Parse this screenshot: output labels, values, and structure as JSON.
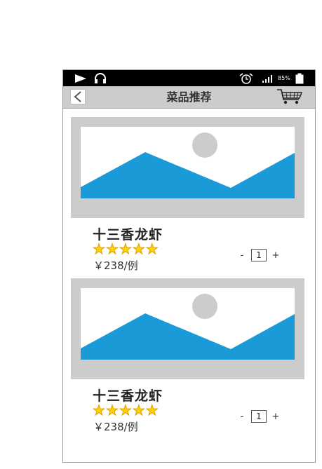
{
  "status_bar": {
    "play_icon": "play-icon",
    "headphones_icon": "headphones-icon",
    "alarm_icon": "alarm-clock-icon",
    "signal_icon": "signal-icon",
    "battery_percent": "85%",
    "battery_icon": "battery-icon"
  },
  "nav": {
    "back_icon": "chevron-left-icon",
    "title": "菜品推荐",
    "cart_icon": "shopping-cart-icon"
  },
  "colors": {
    "placeholder_bg": "#cccccc",
    "mountain": "#1a9ad6",
    "sun": "#cccccc",
    "star": "#ffd400"
  },
  "dishes": [
    {
      "name": "十三香龙虾",
      "rating": 5,
      "price": "￥238/例",
      "qty_minus": "-",
      "qty": "1",
      "qty_plus": "+"
    },
    {
      "name": "十三香龙虾",
      "rating": 5,
      "price": "￥238/例",
      "qty_minus": "-",
      "qty": "1",
      "qty_plus": "+"
    }
  ]
}
